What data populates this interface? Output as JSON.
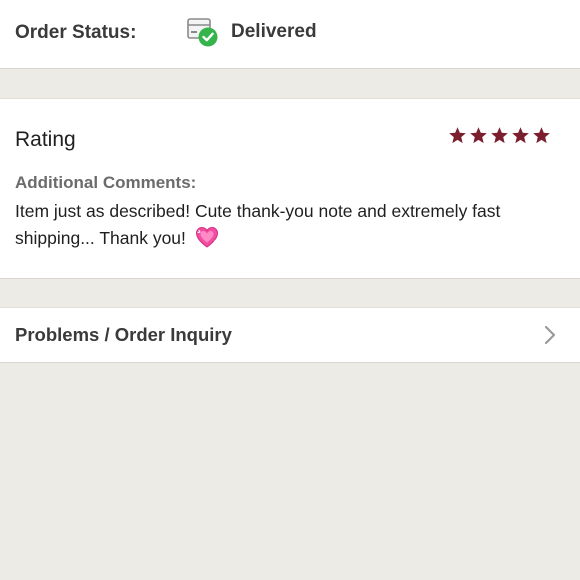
{
  "order_status": {
    "label": "Order Status:",
    "value": "Delivered",
    "icon": "package-delivered-icon"
  },
  "rating": {
    "title": "Rating",
    "stars": 5,
    "max_stars": 5,
    "star_color": "#7b1f2e"
  },
  "comments": {
    "label": "Additional Comments:",
    "text": "Item just as described! Cute thank-you note and extremely fast shipping... Thank you!",
    "emoji": "sparkling-heart-icon"
  },
  "inquiry": {
    "label": "Problems / Order Inquiry",
    "icon": "chevron-right-icon"
  },
  "colors": {
    "background": "#edebe6",
    "delivered_green": "#34b44a",
    "heart_pink": "#f24da0"
  }
}
